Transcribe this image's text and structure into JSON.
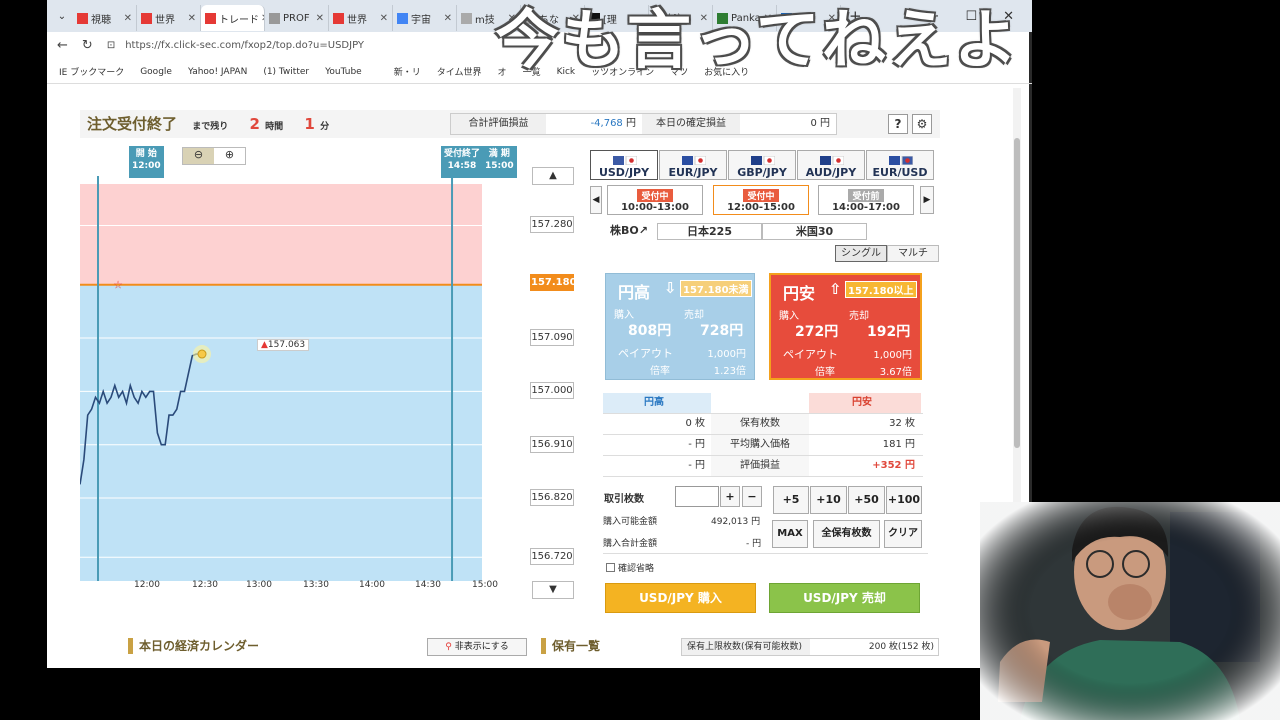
{
  "browser": {
    "tabs": [
      {
        "label": "視聴",
        "color": "#e53935"
      },
      {
        "label": "世界",
        "color": "#e53935"
      },
      {
        "label": "トレード",
        "color": "#e53935"
      },
      {
        "label": "PROF",
        "color": "#999"
      },
      {
        "label": "世界",
        "color": "#e53935"
      },
      {
        "label": "宇宙",
        "color": "#4285f4"
      },
      {
        "label": "m技",
        "color": "#aaa"
      },
      {
        "label": "ちな",
        "color": "#aaa"
      },
      {
        "label": "[理",
        "color": "#111"
      },
      {
        "label": "(4)",
        "color": "#000"
      },
      {
        "label": "Panka",
        "color": "#2e7d32"
      },
      {
        "label": "中エ",
        "color": "#1565c0"
      }
    ],
    "url": "https://fx.click-sec.com/fxop2/top.do?u=USDJPY",
    "bookmarks": [
      "IE ブックマーク",
      "Google",
      "Yahoo! JAPAN",
      "(1) Twitter",
      "YouTube",
      "",
      "新・リ",
      "タイム世界",
      "オ",
      "一覧",
      "Kick",
      "ッツオンライン",
      "マツ",
      "お気に入り"
    ]
  },
  "header": {
    "title": "注文受付終了",
    "remain": "まで残り",
    "hours": "2",
    "hours_unit": "時間",
    "minutes": "1",
    "minutes_unit": "分",
    "pnl_label": "合計評価損益",
    "pnl_value": "-4,768",
    "yen": "円",
    "confirmed_label": "本日の確定損益",
    "confirmed_value": "0",
    "help": "?"
  },
  "chart": {
    "start_label": "開 始",
    "start_time": "12:00",
    "close_label": "受付終了",
    "close_time": "14:58",
    "expire_label": "満 期",
    "expire_time": "15:00",
    "current_price": "157.063",
    "target_price": "157.180"
  },
  "chart_data": {
    "type": "line",
    "x": [
      "12:00",
      "12:02",
      "12:04",
      "12:06",
      "12:08",
      "12:10",
      "12:12",
      "12:14",
      "12:16",
      "12:18",
      "12:20",
      "12:22",
      "12:24",
      "12:26",
      "12:28",
      "12:30",
      "12:32",
      "12:34",
      "12:36",
      "12:38",
      "12:40",
      "12:42",
      "12:44",
      "12:46",
      "12:48",
      "12:50",
      "12:52",
      "12:54",
      "12:56",
      "12:58",
      "13:00",
      "13:01"
    ],
    "values": [
      156.843,
      156.885,
      156.96,
      156.97,
      156.99,
      156.98,
      157.0,
      156.98,
      156.99,
      157.01,
      156.99,
      157.0,
      156.98,
      157.01,
      156.99,
      156.98,
      157.0,
      156.99,
      157.0,
      157.0,
      156.93,
      156.91,
      156.91,
      156.96,
      156.96,
      156.97,
      157.0,
      157.0,
      157.03,
      157.06,
      157.063,
      157.063
    ],
    "target": 157.18,
    "yticks": [
      "157.280",
      "157.090",
      "157.000",
      "156.910",
      "156.820",
      "156.720"
    ],
    "xticks": [
      "12:00",
      "12:30",
      "13:00",
      "13:30",
      "14:00",
      "14:30",
      "15:00"
    ],
    "ylim": [
      156.68,
      157.35
    ]
  },
  "pairs": [
    {
      "label": "USD/JPY"
    },
    {
      "label": "EUR/JPY"
    },
    {
      "label": "GBP/JPY"
    },
    {
      "label": "AUD/JPY"
    },
    {
      "label": "EUR/USD"
    }
  ],
  "sessions": [
    {
      "status": "受付中",
      "time": "10:00-13:00"
    },
    {
      "status": "受付中",
      "time": "12:00-15:00"
    },
    {
      "status": "受付前",
      "time": "14:00-17:00"
    }
  ],
  "indices": [
    "株BO↗",
    "日本225",
    "米国30"
  ],
  "modes": [
    "シングル",
    "マルチ"
  ],
  "yen_high": {
    "title": "円高",
    "cond": "157.180未満",
    "buy": "購入",
    "sell": "売却",
    "buy_price": "808円",
    "sell_price": "728円",
    "payout_label": "ペイアウト",
    "payout": "1,000円",
    "rate_label": "倍率",
    "rate": "1.23倍"
  },
  "yen_low": {
    "title": "円安",
    "cond": "157.180以上",
    "buy": "購入",
    "sell": "売却",
    "buy_price": "272円",
    "sell_price": "192円",
    "payout_label": "ペイアウト",
    "payout": "1,000円",
    "rate_label": "倍率",
    "rate": "3.67倍"
  },
  "holdings": {
    "h_high": "円高",
    "h_low": "円安",
    "rows": [
      {
        "l": "0 枚",
        "m": "保有枚数",
        "r": "32 枚"
      },
      {
        "l": "- 円",
        "m": "平均購入価格",
        "r": "181 円"
      },
      {
        "l": "- 円",
        "m": "評価損益",
        "r": "+352 円"
      }
    ]
  },
  "order": {
    "qty_label": "取引枚数",
    "plus": "+",
    "minus": "−",
    "q5": "+5",
    "q10": "+10",
    "q50": "+50",
    "q100": "+100",
    "avail_label": "購入可能金額",
    "avail": "492,013 円",
    "total_label": "購入合計金額",
    "total": "- 円",
    "max": "MAX",
    "allpos": "全保有枚数",
    "clear": "クリア",
    "confirm": "確認省略",
    "buy": "USD/JPY 購入",
    "sell": "USD/JPY 売却"
  },
  "footer": {
    "calendar": "本日の経済カレンダー",
    "hide": "非表示にする",
    "holdlist": "保有一覧",
    "limit_label": "保有上限枚数(保有可能枚数)",
    "limit": "200 枚(152 枚)"
  },
  "caption": "今も言ってねえよ"
}
